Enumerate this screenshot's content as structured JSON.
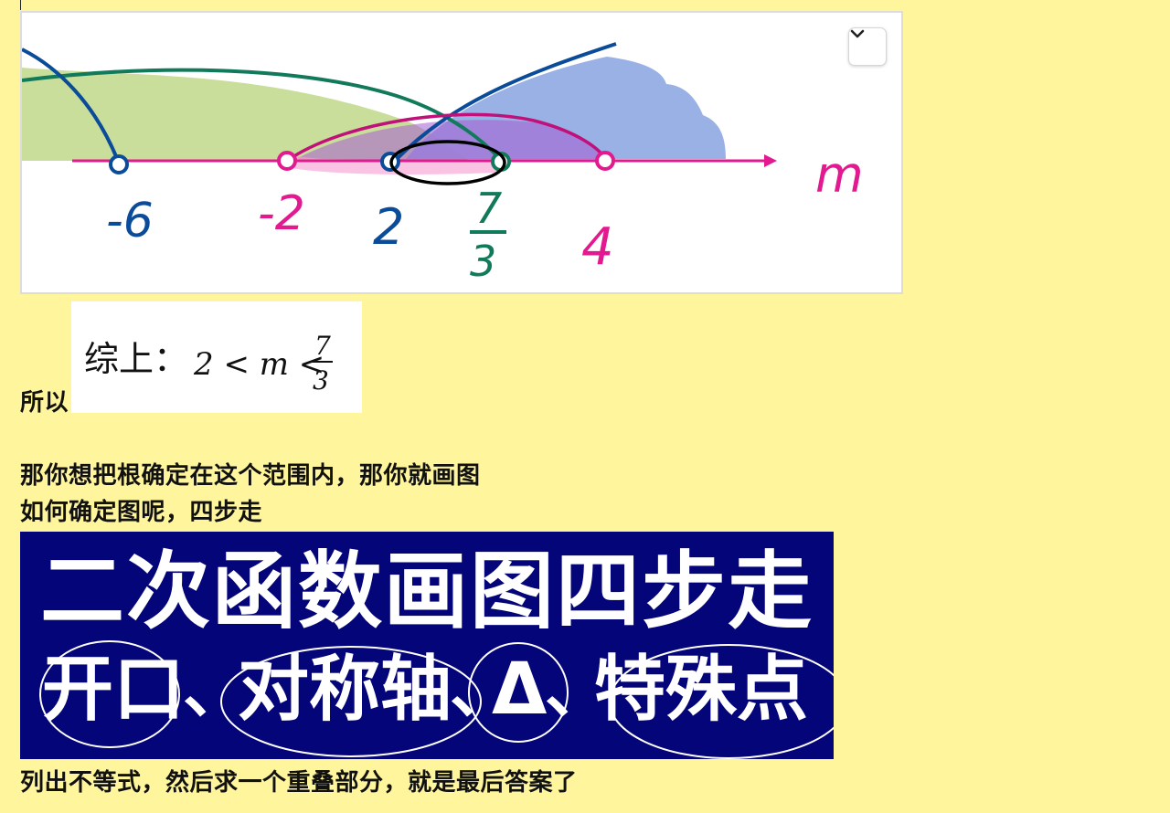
{
  "figure": {
    "axis_label": "m",
    "ticks": [
      {
        "label": "-6",
        "color": "#0B4C9A"
      },
      {
        "label": "-2",
        "color": "#E2198F"
      },
      {
        "label": "2",
        "color": "#0B4C9A"
      },
      {
        "label": "7",
        "label_den": "3",
        "color": "#117A5A"
      },
      {
        "label": "4",
        "color": "#E2198F"
      }
    ],
    "colors": {
      "axis": "#E2198F",
      "green_region": "#BFD88A",
      "blue_region": "#8FA8E2",
      "purple_region": "#9B4FC9",
      "teal_curve": "#117A5A",
      "blue_curve": "#0B4C9A",
      "magenta_curve": "#C0107A"
    },
    "expand_icon": "chevron-down-icon"
  },
  "line_so": "所以",
  "conclusion": {
    "prefix": "综上：",
    "expr": "2 < m <",
    "frac_num": "7",
    "frac_den": "3"
  },
  "line_root_range": "那你想把根确定在这个范围内，那你就画图",
  "line_how": "如何确定图呢，四步走",
  "banner": {
    "title": "二次函数画图四步走",
    "steps": [
      "开口",
      "对称轴",
      "Δ",
      "特殊点"
    ],
    "separator": "、",
    "background": "#05057A"
  },
  "line_final": "列出不等式，然后求一个重叠部分，就是最后答案了"
}
